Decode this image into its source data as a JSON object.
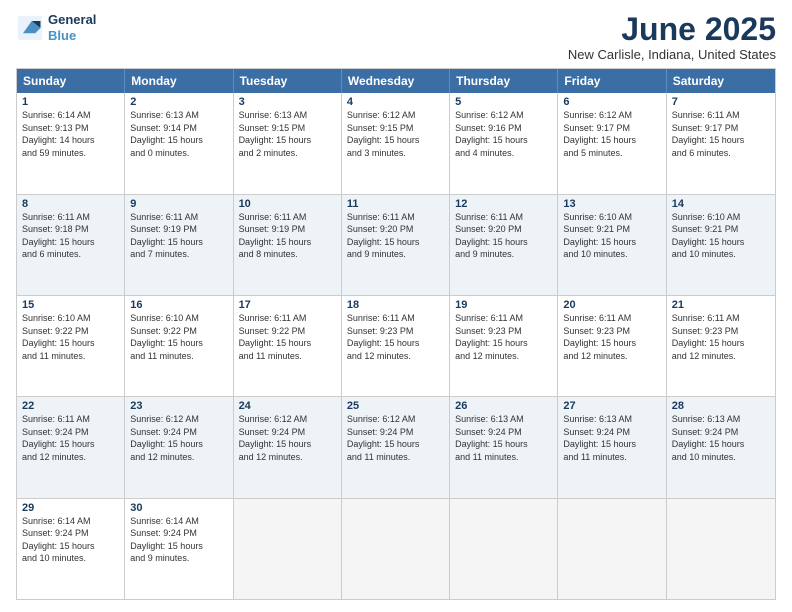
{
  "logo": {
    "line1": "General",
    "line2": "Blue"
  },
  "title": "June 2025",
  "location": "New Carlisle, Indiana, United States",
  "headers": [
    "Sunday",
    "Monday",
    "Tuesday",
    "Wednesday",
    "Thursday",
    "Friday",
    "Saturday"
  ],
  "rows": [
    [
      {
        "day": "1",
        "info": "Sunrise: 6:14 AM\nSunset: 9:13 PM\nDaylight: 14 hours\nand 59 minutes."
      },
      {
        "day": "2",
        "info": "Sunrise: 6:13 AM\nSunset: 9:14 PM\nDaylight: 15 hours\nand 0 minutes."
      },
      {
        "day": "3",
        "info": "Sunrise: 6:13 AM\nSunset: 9:15 PM\nDaylight: 15 hours\nand 2 minutes."
      },
      {
        "day": "4",
        "info": "Sunrise: 6:12 AM\nSunset: 9:15 PM\nDaylight: 15 hours\nand 3 minutes."
      },
      {
        "day": "5",
        "info": "Sunrise: 6:12 AM\nSunset: 9:16 PM\nDaylight: 15 hours\nand 4 minutes."
      },
      {
        "day": "6",
        "info": "Sunrise: 6:12 AM\nSunset: 9:17 PM\nDaylight: 15 hours\nand 5 minutes."
      },
      {
        "day": "7",
        "info": "Sunrise: 6:11 AM\nSunset: 9:17 PM\nDaylight: 15 hours\nand 6 minutes."
      }
    ],
    [
      {
        "day": "8",
        "info": "Sunrise: 6:11 AM\nSunset: 9:18 PM\nDaylight: 15 hours\nand 6 minutes."
      },
      {
        "day": "9",
        "info": "Sunrise: 6:11 AM\nSunset: 9:19 PM\nDaylight: 15 hours\nand 7 minutes."
      },
      {
        "day": "10",
        "info": "Sunrise: 6:11 AM\nSunset: 9:19 PM\nDaylight: 15 hours\nand 8 minutes."
      },
      {
        "day": "11",
        "info": "Sunrise: 6:11 AM\nSunset: 9:20 PM\nDaylight: 15 hours\nand 9 minutes."
      },
      {
        "day": "12",
        "info": "Sunrise: 6:11 AM\nSunset: 9:20 PM\nDaylight: 15 hours\nand 9 minutes."
      },
      {
        "day": "13",
        "info": "Sunrise: 6:10 AM\nSunset: 9:21 PM\nDaylight: 15 hours\nand 10 minutes."
      },
      {
        "day": "14",
        "info": "Sunrise: 6:10 AM\nSunset: 9:21 PM\nDaylight: 15 hours\nand 10 minutes."
      }
    ],
    [
      {
        "day": "15",
        "info": "Sunrise: 6:10 AM\nSunset: 9:22 PM\nDaylight: 15 hours\nand 11 minutes."
      },
      {
        "day": "16",
        "info": "Sunrise: 6:10 AM\nSunset: 9:22 PM\nDaylight: 15 hours\nand 11 minutes."
      },
      {
        "day": "17",
        "info": "Sunrise: 6:11 AM\nSunset: 9:22 PM\nDaylight: 15 hours\nand 11 minutes."
      },
      {
        "day": "18",
        "info": "Sunrise: 6:11 AM\nSunset: 9:23 PM\nDaylight: 15 hours\nand 12 minutes."
      },
      {
        "day": "19",
        "info": "Sunrise: 6:11 AM\nSunset: 9:23 PM\nDaylight: 15 hours\nand 12 minutes."
      },
      {
        "day": "20",
        "info": "Sunrise: 6:11 AM\nSunset: 9:23 PM\nDaylight: 15 hours\nand 12 minutes."
      },
      {
        "day": "21",
        "info": "Sunrise: 6:11 AM\nSunset: 9:23 PM\nDaylight: 15 hours\nand 12 minutes."
      }
    ],
    [
      {
        "day": "22",
        "info": "Sunrise: 6:11 AM\nSunset: 9:24 PM\nDaylight: 15 hours\nand 12 minutes."
      },
      {
        "day": "23",
        "info": "Sunrise: 6:12 AM\nSunset: 9:24 PM\nDaylight: 15 hours\nand 12 minutes."
      },
      {
        "day": "24",
        "info": "Sunrise: 6:12 AM\nSunset: 9:24 PM\nDaylight: 15 hours\nand 12 minutes."
      },
      {
        "day": "25",
        "info": "Sunrise: 6:12 AM\nSunset: 9:24 PM\nDaylight: 15 hours\nand 11 minutes."
      },
      {
        "day": "26",
        "info": "Sunrise: 6:13 AM\nSunset: 9:24 PM\nDaylight: 15 hours\nand 11 minutes."
      },
      {
        "day": "27",
        "info": "Sunrise: 6:13 AM\nSunset: 9:24 PM\nDaylight: 15 hours\nand 11 minutes."
      },
      {
        "day": "28",
        "info": "Sunrise: 6:13 AM\nSunset: 9:24 PM\nDaylight: 15 hours\nand 10 minutes."
      }
    ],
    [
      {
        "day": "29",
        "info": "Sunrise: 6:14 AM\nSunset: 9:24 PM\nDaylight: 15 hours\nand 10 minutes."
      },
      {
        "day": "30",
        "info": "Sunrise: 6:14 AM\nSunset: 9:24 PM\nDaylight: 15 hours\nand 9 minutes."
      },
      {
        "day": "",
        "info": ""
      },
      {
        "day": "",
        "info": ""
      },
      {
        "day": "",
        "info": ""
      },
      {
        "day": "",
        "info": ""
      },
      {
        "day": "",
        "info": ""
      }
    ]
  ]
}
